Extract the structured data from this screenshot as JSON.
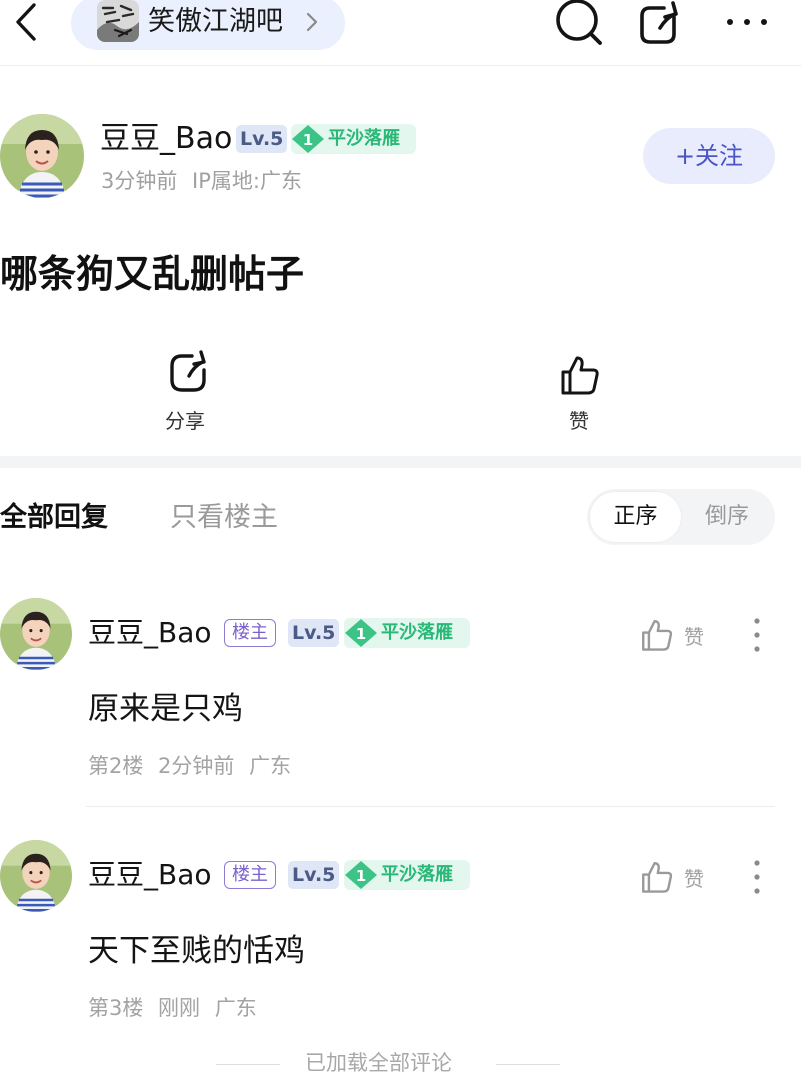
{
  "topbar": {
    "forum_name": "笑傲江湖吧",
    "back_icon": "chevron-left-icon",
    "search_icon": "search-icon",
    "share_icon": "share-icon",
    "more_icon": "more-icon"
  },
  "author": {
    "name": "豆豆_Bao",
    "level": "Lv.5",
    "rank_number": "1",
    "rank_title": "平沙落雁",
    "meta": "3分钟前 IP属地:广东",
    "follow_label": "+关注"
  },
  "post": {
    "title": "哪条狗又乱删帖子",
    "share_label": "分享",
    "like_label": "赞"
  },
  "tabs": {
    "all_replies": "全部回复",
    "owner_only": "只看楼主",
    "sort_asc": "正序",
    "sort_desc": "倒序"
  },
  "replies": [
    {
      "name": "豆豆_Bao",
      "owner_badge": "楼主",
      "level": "Lv.5",
      "rank_number": "1",
      "rank_title": "平沙落雁",
      "like_label": "赞",
      "content": "原来是只鸡",
      "meta": "第2楼 2分钟前 广东"
    },
    {
      "name": "豆豆_Bao",
      "owner_badge": "楼主",
      "level": "Lv.5",
      "rank_number": "1",
      "rank_title": "平沙落雁",
      "like_label": "赞",
      "content": "天下至贱的恬鸡",
      "meta": "第3楼 刚刚 广东"
    }
  ],
  "footer": {
    "text": "已加载全部评论"
  },
  "colors": {
    "accent": "#4a54c7",
    "rank_green": "#29b877",
    "owner_purple": "#7a61cc",
    "muted": "#a0a0a0"
  }
}
